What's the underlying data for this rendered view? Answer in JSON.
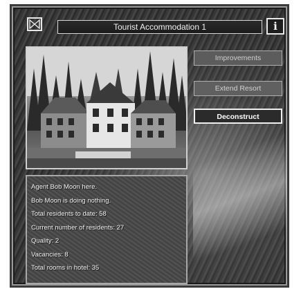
{
  "window": {
    "title": "Tourist Accommodation 1",
    "info_label": "i",
    "close_icon": "bowtie-close-icon"
  },
  "photo": {
    "subject": "hotel-photo"
  },
  "actions": {
    "improvements": "Improvements",
    "extend": "Extend Resort",
    "deconstruct": "Deconstruct"
  },
  "status": {
    "lines": [
      "Agent Bob Moon here.",
      "Bob Moon is doing nothing.",
      "Total residents to date: 58",
      "Current number of residents: 27",
      "Quality: 2",
      "Vacancies: 8",
      "Total rooms in hotel: 35"
    ]
  }
}
